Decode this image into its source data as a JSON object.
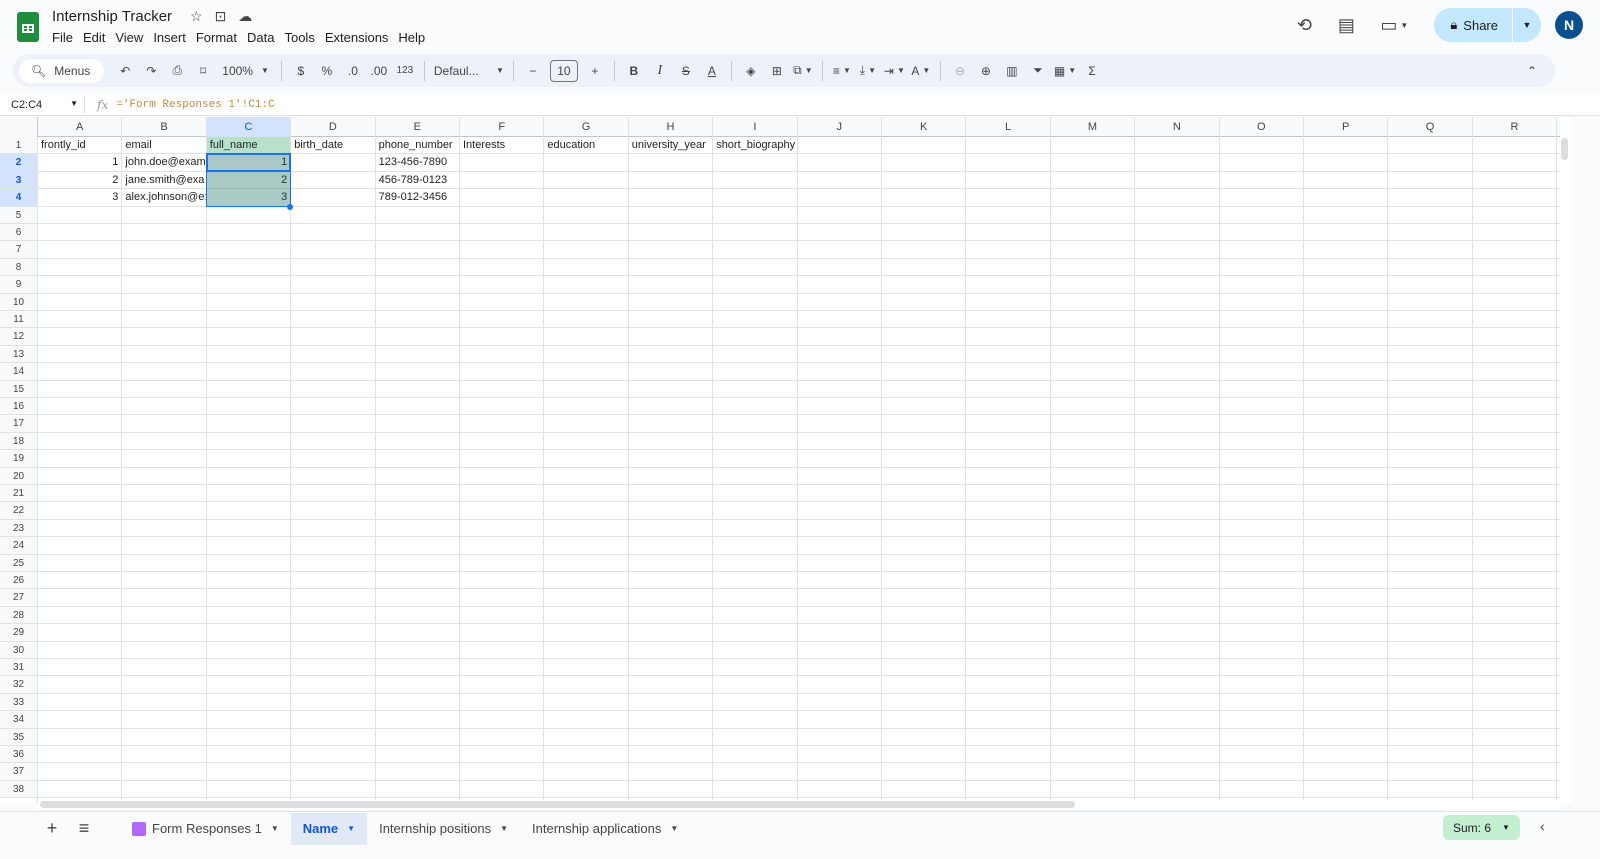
{
  "app": {
    "title": "Internship Tracker",
    "menu": [
      "File",
      "Edit",
      "View",
      "Insert",
      "Format",
      "Data",
      "Tools",
      "Extensions",
      "Help"
    ],
    "share_label": "Share",
    "avatar_initial": "N"
  },
  "toolbar": {
    "search_label": "Menus",
    "zoom": "100%",
    "currency": "$",
    "percent": "%",
    "dec_decrease": ".0",
    "dec_increase": ".00",
    "format_number": "123",
    "font": "Defaul...",
    "font_size": "10",
    "bold": "B",
    "italic": "I",
    "strike": "S",
    "text_color": "A",
    "sum_icon": "Σ"
  },
  "formula_bar": {
    "name_box": "C2:C4",
    "fx": "fx",
    "formula": "='Form Responses 1'!C1:C"
  },
  "columns": [
    "A",
    "B",
    "C",
    "D",
    "E",
    "F",
    "G",
    "H",
    "I",
    "J",
    "K",
    "L",
    "M",
    "N",
    "O",
    "P",
    "Q",
    "R"
  ],
  "rows_visible": 38,
  "cells": {
    "header": [
      "frontly_id",
      "email",
      "full_name",
      "birth_date",
      "phone_number",
      "Interests",
      "education",
      "university_year",
      "short_biography"
    ],
    "data": [
      {
        "a": "1",
        "b": "john.doe@exam",
        "c": "1",
        "e": "123-456-7890"
      },
      {
        "a": "2",
        "b": "jane.smith@exa",
        "c": "2",
        "e": "456-789-0123"
      },
      {
        "a": "3",
        "b": "alex.johnson@e:",
        "c": "3",
        "e": "789-012-3456"
      }
    ]
  },
  "sheets": [
    {
      "label": "Form Responses 1",
      "active": false,
      "form": true
    },
    {
      "label": "Name",
      "active": true
    },
    {
      "label": "Internship positions",
      "active": false
    },
    {
      "label": "Internship applications",
      "active": false
    }
  ],
  "status": {
    "sum": "Sum: 6"
  },
  "colors": {
    "accent": "#0b57d0",
    "selection": "#1a73e8",
    "share_bg": "#c2e7ff",
    "sum_bg": "#c4eed0"
  }
}
